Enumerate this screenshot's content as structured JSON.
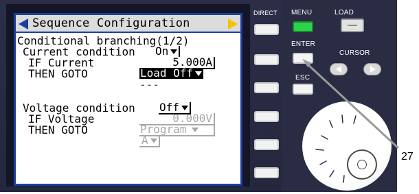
{
  "screen": {
    "title": "Sequence Configuration",
    "heading": "Conditional branching(1/2)",
    "current": {
      "label": "Current condition",
      "condition_value": "On",
      "if_label": "IF Current",
      "if_value": "5.000A",
      "then_label": "THEN GOTO",
      "then_value": "Load Off",
      "dashes": "---"
    },
    "voltage": {
      "label": "Voltage condition",
      "condition_value": "Off",
      "if_label": "IF Voltage",
      "if_value": "0.000V",
      "then_label": "THEN GOTO",
      "then_value": "Program",
      "step_value": "A"
    }
  },
  "controls": {
    "direct_label": "DIRECT",
    "menu_label": "MENU",
    "load_label": "LOAD",
    "enter_label": "ENTER",
    "cursor_label": "CURSOR",
    "esc_label": "ESC"
  },
  "callout": "27",
  "colors": {
    "panel": "#2a2c44",
    "lcd_border": "#1b3fa0",
    "menu_led": "#2bd34a",
    "title_arrow_right": "#f2c400"
  }
}
